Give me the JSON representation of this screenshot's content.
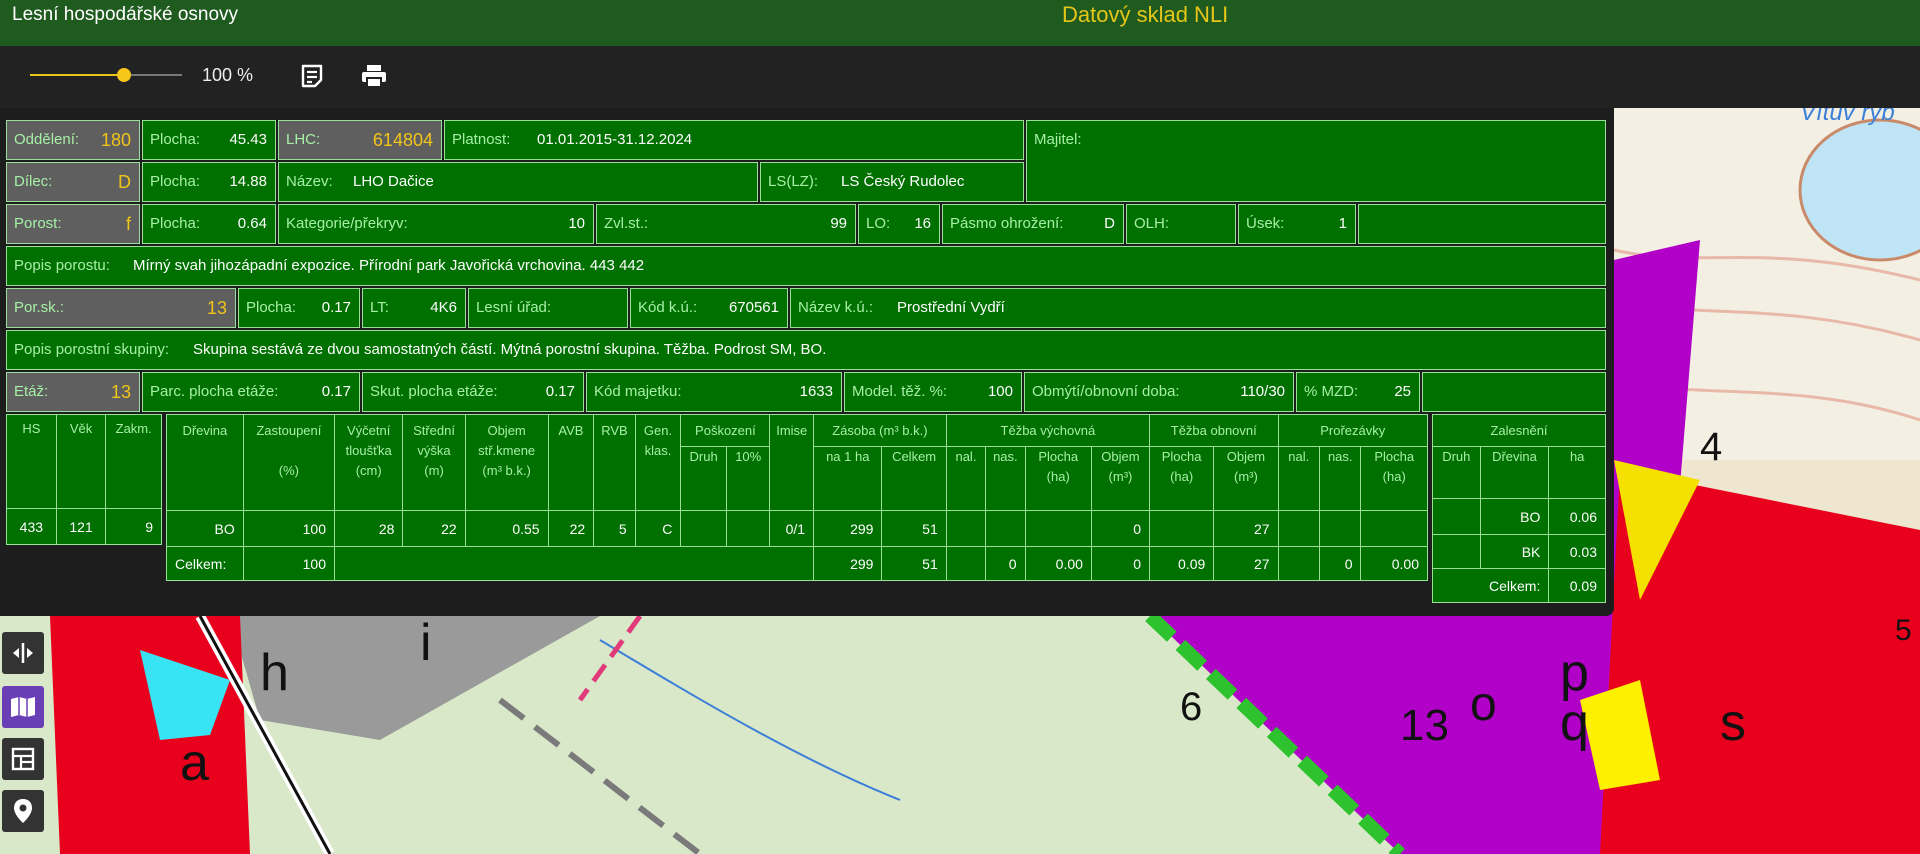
{
  "header": {
    "app_title": "Lesní hospodářské osnovy",
    "center_title": "Datový sklad NLI"
  },
  "toolbar": {
    "zoom_label": "100 %",
    "zoom_value": 0.62,
    "report_icon": "report-icon",
    "print_icon": "print-icon"
  },
  "colors": {
    "top_bar": "#1f5a1f",
    "cell_green": "#007000",
    "accent_yellow": "#f0c419"
  },
  "info": {
    "oddeleni": {
      "label": "Oddělení:",
      "value": "180"
    },
    "plocha1": {
      "label": "Plocha:",
      "value": "45.43"
    },
    "lhc": {
      "label": "LHC:",
      "value": "614804"
    },
    "platnost": {
      "label": "Platnost:",
      "value": "01.01.2015-31.12.2024"
    },
    "majitel": {
      "label": "Majitel:",
      "value": ""
    },
    "dilec": {
      "label": "Dílec:",
      "value": "D"
    },
    "plocha2": {
      "label": "Plocha:",
      "value": "14.88"
    },
    "nazev": {
      "label": "Název:",
      "value": "LHO Dačice"
    },
    "ls": {
      "label": "LS(LZ):",
      "value": "LS Český Rudolec"
    },
    "porost": {
      "label": "Porost:",
      "value": "f"
    },
    "plocha3": {
      "label": "Plocha:",
      "value": "0.64"
    },
    "kategorie": {
      "label": "Kategorie/překryv:",
      "value": "10"
    },
    "zvlst": {
      "label": "Zvl.st.:",
      "value": "99"
    },
    "lo": {
      "label": "LO:",
      "value": "16"
    },
    "pasmo": {
      "label": "Pásmo ohrožení:",
      "value": "D"
    },
    "olh": {
      "label": "OLH:",
      "value": ""
    },
    "usek": {
      "label": "Úsek:",
      "value": "1"
    },
    "popis_porostu": {
      "label": "Popis porostu:",
      "value": "Mírný svah jihozápadní expozice. Přírodní park Javořická vrchovina. 443 442"
    },
    "porsk": {
      "label": "Por.sk.:",
      "value": "13"
    },
    "plocha4": {
      "label": "Plocha:",
      "value": "0.17"
    },
    "lt": {
      "label": "LT:",
      "value": "4K6"
    },
    "lesni_urad": {
      "label": "Lesní úřad:",
      "value": ""
    },
    "kod_ku": {
      "label": "Kód k.ú.:",
      "value": "670561"
    },
    "nazev_ku": {
      "label": "Název k.ú.:",
      "value": "Prostřední Vydří"
    },
    "popis_skupiny": {
      "label": "Popis porostní skupiny:",
      "value": "Skupina sestává ze dvou samostatných částí. Mýtná porostní skupina. Těžba. Podrost SM, BO."
    },
    "etaz": {
      "label": "Etáž:",
      "value": "13"
    },
    "parc_plocha": {
      "label": "Parc. plocha etáže:",
      "value": "0.17"
    },
    "skut_plocha": {
      "label": "Skut. plocha etáže:",
      "value": "0.17"
    },
    "kod_majetku": {
      "label": "Kód majetku:",
      "value": "1633"
    },
    "model_tez": {
      "label": "Model. těž. %:",
      "value": "100"
    },
    "obmyti": {
      "label": "Obmýtí/obnovní doba:",
      "value": "110/30"
    },
    "mzd": {
      "label": "% MZD:",
      "value": "25"
    }
  },
  "age_table": {
    "headers": [
      "HS",
      "Věk",
      "Zakm."
    ],
    "row": [
      "433",
      "121",
      "9"
    ]
  },
  "species_table": {
    "headers": {
      "drevina": "Dřevina",
      "zastoupeni": "Zastoupení",
      "zastoupeni_unit": "(%)",
      "vycetni": "Výčetní",
      "vycetni2": "tloušťka",
      "vycetni_unit": "(cm)",
      "stredni": "Střední",
      "stredni2": "výška",
      "stredni_unit": "(m)",
      "objem": "Objem",
      "objem2": "stř.kmene",
      "objem_unit": "(m³ b.k.)",
      "avb": "AVB",
      "rvb": "RVB",
      "gen": "Gen.",
      "gen2": "klas.",
      "poskozeni": "Poškození",
      "druh": "Druh",
      "pct10": "10%",
      "imise": "Imise",
      "zasoba": "Zásoba (m³ b.k.)",
      "na1ha": "na 1 ha",
      "celkem": "Celkem",
      "tezba_vych": "Těžba výchovná",
      "nal": "nal.",
      "nas": "nas.",
      "plocha": "Plocha",
      "ha_unit": "(ha)",
      "objem_t": "Objem",
      "m3_unit": "(m³)",
      "tezba_obn": "Těžba obnovní",
      "prorezavky": "Prořezávky"
    },
    "rows": [
      {
        "drevina": "BO",
        "zastoupeni": "100",
        "tloustka": "28",
        "vyska": "22",
        "objem": "0.55",
        "avb": "22",
        "rvb": "5",
        "gen": "C",
        "druh": "",
        "p10": "",
        "imise": "0/1",
        "na1ha": "299",
        "celkem": "51",
        "tv_nal": "",
        "tv_nas": "",
        "tv_plocha": "",
        "tv_objem": "0",
        "to_plocha": "",
        "to_objem": "27",
        "pr_nal": "",
        "pr_nas": "",
        "pr_plocha": ""
      }
    ],
    "total": {
      "label": "Celkem:",
      "zastoupeni": "100",
      "na1ha": "299",
      "celkem": "51",
      "tv_nas": "0",
      "tv_plocha": "0.00",
      "tv_objem": "0",
      "to_plocha": "0.09",
      "to_objem": "27",
      "pr_nas": "0",
      "pr_plocha": "0.00"
    }
  },
  "afforestation_table": {
    "title": "Zalesnění",
    "headers": [
      "Druh",
      "Dřevina",
      "ha"
    ],
    "rows": [
      {
        "druh": "",
        "drevina": "BO",
        "ha": "0.06"
      },
      {
        "druh": "",
        "drevina": "BK",
        "ha": "0.03"
      }
    ],
    "total": {
      "label": "Celkem:",
      "ha": "0.09"
    }
  },
  "sidebar": {
    "icons": [
      "split-icon",
      "map-book-icon",
      "layout-icon",
      "location-pin-icon"
    ]
  }
}
